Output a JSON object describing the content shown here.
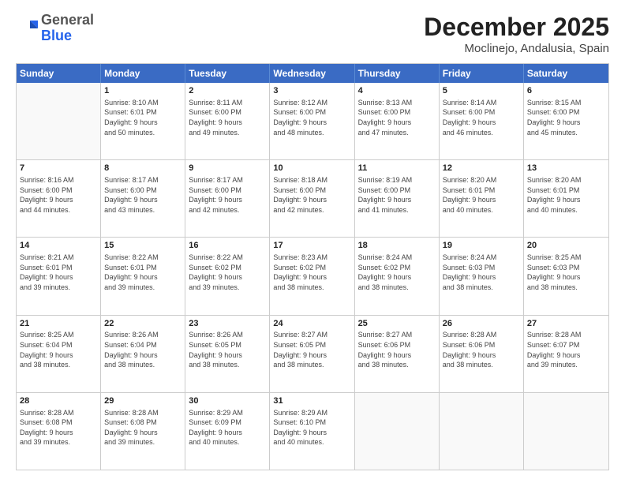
{
  "logo": {
    "general": "General",
    "blue": "Blue"
  },
  "header": {
    "month": "December 2025",
    "location": "Moclinejo, Andalusia, Spain"
  },
  "days_of_week": [
    "Sunday",
    "Monday",
    "Tuesday",
    "Wednesday",
    "Thursday",
    "Friday",
    "Saturday"
  ],
  "weeks": [
    [
      {
        "day": "",
        "lines": []
      },
      {
        "day": "1",
        "lines": [
          "Sunrise: 8:10 AM",
          "Sunset: 6:01 PM",
          "Daylight: 9 hours",
          "and 50 minutes."
        ]
      },
      {
        "day": "2",
        "lines": [
          "Sunrise: 8:11 AM",
          "Sunset: 6:00 PM",
          "Daylight: 9 hours",
          "and 49 minutes."
        ]
      },
      {
        "day": "3",
        "lines": [
          "Sunrise: 8:12 AM",
          "Sunset: 6:00 PM",
          "Daylight: 9 hours",
          "and 48 minutes."
        ]
      },
      {
        "day": "4",
        "lines": [
          "Sunrise: 8:13 AM",
          "Sunset: 6:00 PM",
          "Daylight: 9 hours",
          "and 47 minutes."
        ]
      },
      {
        "day": "5",
        "lines": [
          "Sunrise: 8:14 AM",
          "Sunset: 6:00 PM",
          "Daylight: 9 hours",
          "and 46 minutes."
        ]
      },
      {
        "day": "6",
        "lines": [
          "Sunrise: 8:15 AM",
          "Sunset: 6:00 PM",
          "Daylight: 9 hours",
          "and 45 minutes."
        ]
      }
    ],
    [
      {
        "day": "7",
        "lines": [
          "Sunrise: 8:16 AM",
          "Sunset: 6:00 PM",
          "Daylight: 9 hours",
          "and 44 minutes."
        ]
      },
      {
        "day": "8",
        "lines": [
          "Sunrise: 8:17 AM",
          "Sunset: 6:00 PM",
          "Daylight: 9 hours",
          "and 43 minutes."
        ]
      },
      {
        "day": "9",
        "lines": [
          "Sunrise: 8:17 AM",
          "Sunset: 6:00 PM",
          "Daylight: 9 hours",
          "and 42 minutes."
        ]
      },
      {
        "day": "10",
        "lines": [
          "Sunrise: 8:18 AM",
          "Sunset: 6:00 PM",
          "Daylight: 9 hours",
          "and 42 minutes."
        ]
      },
      {
        "day": "11",
        "lines": [
          "Sunrise: 8:19 AM",
          "Sunset: 6:00 PM",
          "Daylight: 9 hours",
          "and 41 minutes."
        ]
      },
      {
        "day": "12",
        "lines": [
          "Sunrise: 8:20 AM",
          "Sunset: 6:01 PM",
          "Daylight: 9 hours",
          "and 40 minutes."
        ]
      },
      {
        "day": "13",
        "lines": [
          "Sunrise: 8:20 AM",
          "Sunset: 6:01 PM",
          "Daylight: 9 hours",
          "and 40 minutes."
        ]
      }
    ],
    [
      {
        "day": "14",
        "lines": [
          "Sunrise: 8:21 AM",
          "Sunset: 6:01 PM",
          "Daylight: 9 hours",
          "and 39 minutes."
        ]
      },
      {
        "day": "15",
        "lines": [
          "Sunrise: 8:22 AM",
          "Sunset: 6:01 PM",
          "Daylight: 9 hours",
          "and 39 minutes."
        ]
      },
      {
        "day": "16",
        "lines": [
          "Sunrise: 8:22 AM",
          "Sunset: 6:02 PM",
          "Daylight: 9 hours",
          "and 39 minutes."
        ]
      },
      {
        "day": "17",
        "lines": [
          "Sunrise: 8:23 AM",
          "Sunset: 6:02 PM",
          "Daylight: 9 hours",
          "and 38 minutes."
        ]
      },
      {
        "day": "18",
        "lines": [
          "Sunrise: 8:24 AM",
          "Sunset: 6:02 PM",
          "Daylight: 9 hours",
          "and 38 minutes."
        ]
      },
      {
        "day": "19",
        "lines": [
          "Sunrise: 8:24 AM",
          "Sunset: 6:03 PM",
          "Daylight: 9 hours",
          "and 38 minutes."
        ]
      },
      {
        "day": "20",
        "lines": [
          "Sunrise: 8:25 AM",
          "Sunset: 6:03 PM",
          "Daylight: 9 hours",
          "and 38 minutes."
        ]
      }
    ],
    [
      {
        "day": "21",
        "lines": [
          "Sunrise: 8:25 AM",
          "Sunset: 6:04 PM",
          "Daylight: 9 hours",
          "and 38 minutes."
        ]
      },
      {
        "day": "22",
        "lines": [
          "Sunrise: 8:26 AM",
          "Sunset: 6:04 PM",
          "Daylight: 9 hours",
          "and 38 minutes."
        ]
      },
      {
        "day": "23",
        "lines": [
          "Sunrise: 8:26 AM",
          "Sunset: 6:05 PM",
          "Daylight: 9 hours",
          "and 38 minutes."
        ]
      },
      {
        "day": "24",
        "lines": [
          "Sunrise: 8:27 AM",
          "Sunset: 6:05 PM",
          "Daylight: 9 hours",
          "and 38 minutes."
        ]
      },
      {
        "day": "25",
        "lines": [
          "Sunrise: 8:27 AM",
          "Sunset: 6:06 PM",
          "Daylight: 9 hours",
          "and 38 minutes."
        ]
      },
      {
        "day": "26",
        "lines": [
          "Sunrise: 8:28 AM",
          "Sunset: 6:06 PM",
          "Daylight: 9 hours",
          "and 38 minutes."
        ]
      },
      {
        "day": "27",
        "lines": [
          "Sunrise: 8:28 AM",
          "Sunset: 6:07 PM",
          "Daylight: 9 hours",
          "and 39 minutes."
        ]
      }
    ],
    [
      {
        "day": "28",
        "lines": [
          "Sunrise: 8:28 AM",
          "Sunset: 6:08 PM",
          "Daylight: 9 hours",
          "and 39 minutes."
        ]
      },
      {
        "day": "29",
        "lines": [
          "Sunrise: 8:28 AM",
          "Sunset: 6:08 PM",
          "Daylight: 9 hours",
          "and 39 minutes."
        ]
      },
      {
        "day": "30",
        "lines": [
          "Sunrise: 8:29 AM",
          "Sunset: 6:09 PM",
          "Daylight: 9 hours",
          "and 40 minutes."
        ]
      },
      {
        "day": "31",
        "lines": [
          "Sunrise: 8:29 AM",
          "Sunset: 6:10 PM",
          "Daylight: 9 hours",
          "and 40 minutes."
        ]
      },
      {
        "day": "",
        "lines": []
      },
      {
        "day": "",
        "lines": []
      },
      {
        "day": "",
        "lines": []
      }
    ]
  ]
}
